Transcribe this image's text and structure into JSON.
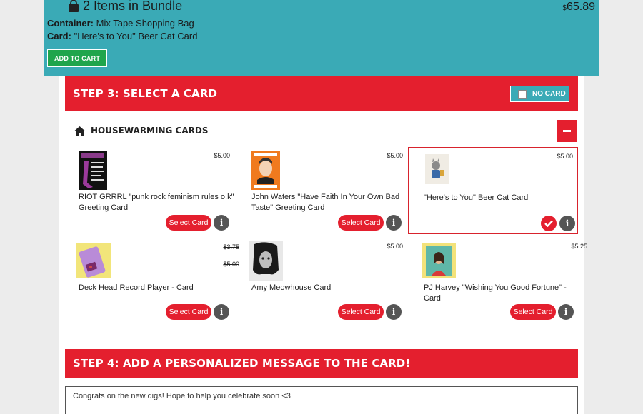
{
  "bundle": {
    "title": "2 Items in Bundle",
    "currency": "$",
    "price": "65.89",
    "container_label": "Container:",
    "container_value": "Mix Tape Shopping Bag",
    "card_label": "Card:",
    "card_value": "\"Here's to You\" Beer Cat Card",
    "add_to_cart_label": "ADD TO CART"
  },
  "step3": {
    "title": "STEP 3: SELECT A CARD",
    "no_card_label": "NO CARD"
  },
  "category": {
    "title": "HOUSEWARMING CARDS"
  },
  "cards": [
    {
      "name": "RIOT GRRRL \"punk rock feminism rules o.k\" Greeting Card",
      "price": "$5.00",
      "button": "Select Card"
    },
    {
      "name": "John Waters \"Have Faith In Your Own Bad Taste\" Greeting Card",
      "price": "$5.00",
      "button": "Select Card"
    },
    {
      "name": "\"Here's to You\" Beer Cat Card",
      "price": "$5.00",
      "selected": true
    },
    {
      "name": "Deck Head Record Player - Card",
      "price": "$3.75",
      "old_price": "$5.00",
      "button": "Select Card"
    },
    {
      "name": "Amy Meowhouse Card",
      "price": "$5.00",
      "button": "Select Card"
    },
    {
      "name": "PJ Harvey \"Wishing You Good Fortune\" - Card",
      "price": "$5.25",
      "button": "Select Card"
    }
  ],
  "info_label": "i",
  "step4": {
    "title": "STEP 4: ADD A PERSONALIZED MESSAGE TO THE CARD!",
    "message": "Congrats on the new digs! Hope to help you celebrate soon <3"
  },
  "icons": {
    "bundle": "shopping-bag-icon",
    "category": "home-icon",
    "collapse": "minus-icon",
    "info": "info-icon",
    "selected": "checkmark-icon"
  },
  "colors": {
    "teal": "#3aaab6",
    "red": "#e41f2e",
    "green": "#1fa54c",
    "grey": "#555555"
  }
}
